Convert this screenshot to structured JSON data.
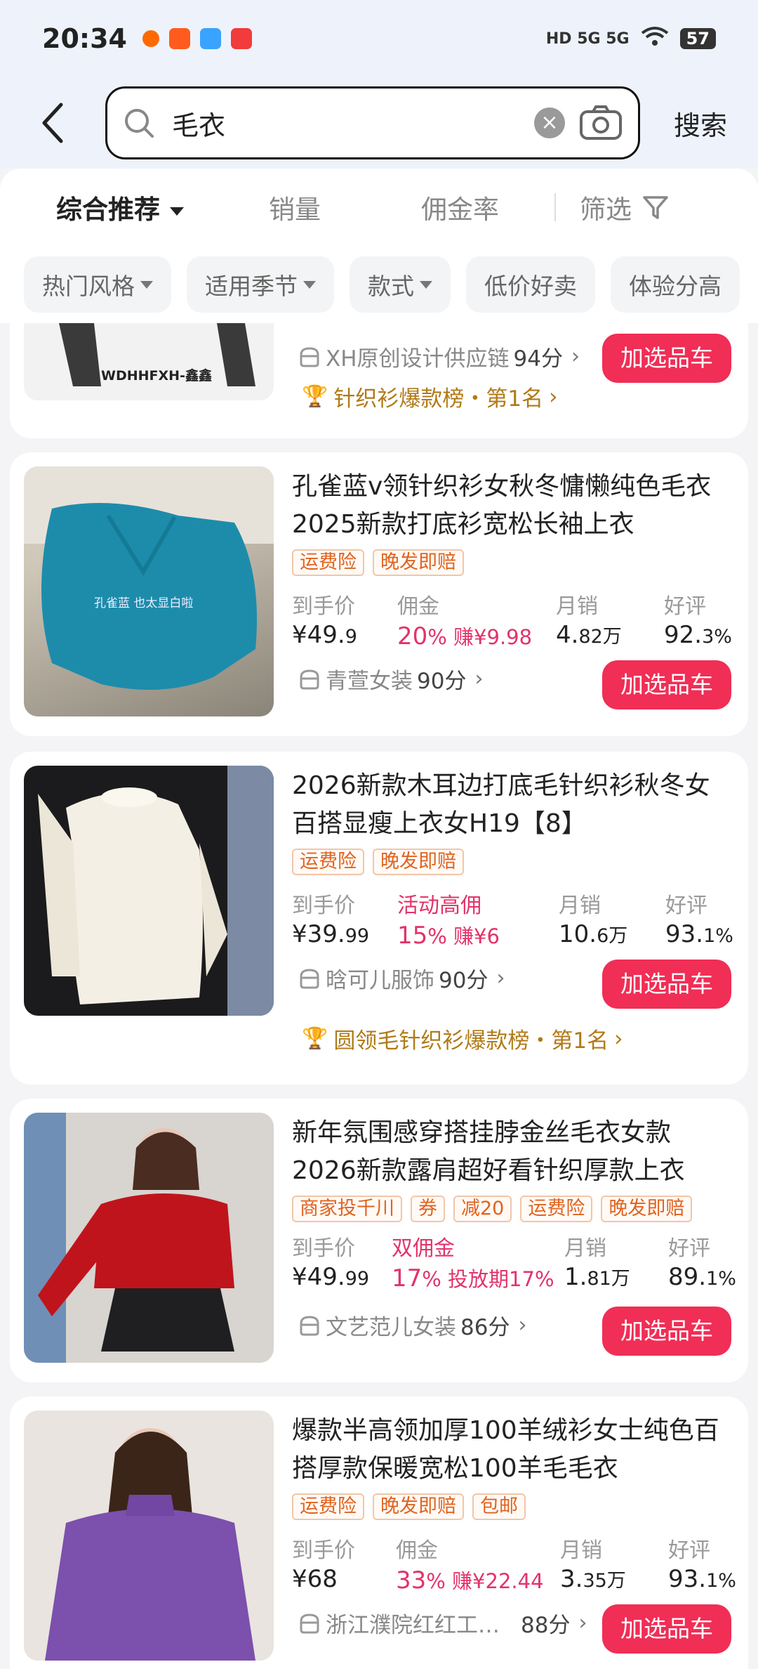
{
  "status": {
    "time": "20:34",
    "indicators": "HD 5G 5G",
    "battery": "57"
  },
  "search": {
    "query": "毛衣",
    "button": "搜索"
  },
  "sort": {
    "items": [
      "综合推荐",
      "销量",
      "佣金率",
      "筛选"
    ]
  },
  "chips": [
    "热门风格",
    "适用季节",
    "款式",
    "低价好卖",
    "体验分高"
  ],
  "products": [
    {
      "image_caption": "WDHHFXH-鑫鑫",
      "shop": "XH原创设计供应链",
      "shop_score": "94分",
      "add_label": "加选品车",
      "rank": "针织衫爆款榜・第1名"
    },
    {
      "title": "孔雀蓝v领针织衫女秋冬慵懒纯色毛衣2025新款打底衫宽松长袖上衣",
      "image_caption": "孔雀蓝 也太显白啦",
      "tags": [
        "运费险",
        "晚发即赔"
      ],
      "price_label": "到手价",
      "price": "¥49.",
      "price_small": "9",
      "commission_label": "佣金",
      "commission_pct": "20",
      "commission_pct_unit": "%",
      "commission_earn": " 赚¥9.98",
      "sales_label": "月销",
      "sales": "4.",
      "sales_small": "82万",
      "rating_label": "好评",
      "rating": "92.",
      "rating_small": "3%",
      "shop": "青萱女装",
      "shop_score": "90分",
      "add_label": "加选品车"
    },
    {
      "title": "2026新款木耳边打底毛针织衫秋冬女百搭显瘦上衣女H19【8】",
      "tags": [
        "运费险",
        "晚发即赔"
      ],
      "price_label": "到手价",
      "price": "¥39.",
      "price_small": "99",
      "commission_label": "活动高佣",
      "commission_pct": "15",
      "commission_pct_unit": "%",
      "commission_earn": " 赚¥6",
      "sales_label": "月销",
      "sales": "10.",
      "sales_small": "6万",
      "rating_label": "好评",
      "rating": "93.",
      "rating_small": "1%",
      "shop": "晗可儿服饰",
      "shop_score": "90分",
      "add_label": "加选品车",
      "rank": "圆领毛针织衫爆款榜・第1名"
    },
    {
      "title": "新年氛围感穿搭挂脖金丝毛衣女款2026新款露肩超好看针织厚款上衣",
      "tags": [
        "商家投千川",
        "券",
        "减20",
        "运费险",
        "晚发即赔"
      ],
      "price_label": "到手价",
      "price": "¥49.",
      "price_small": "99",
      "commission_label": "双佣金",
      "commission_pct": "17",
      "commission_pct_unit": "%",
      "commission_earn": " 投放期17%",
      "sales_label": "月销",
      "sales": "1.",
      "sales_small": "81万",
      "rating_label": "好评",
      "rating": "89.",
      "rating_small": "1%",
      "shop": "文艺范儿女装",
      "shop_score": "86分",
      "add_label": "加选品车"
    },
    {
      "title": "爆款半高领加厚100羊绒衫女士纯色百搭厚款保暖宽松100羊毛毛衣",
      "tags": [
        "运费险",
        "晚发即赔",
        "包邮"
      ],
      "price_label": "到手价",
      "price": "¥68",
      "price_small": "",
      "commission_label": "佣金",
      "commission_pct": "33",
      "commission_pct_unit": "%",
      "commission_earn": " 赚¥22.44",
      "sales_label": "月销",
      "sales": "3.",
      "sales_small": "35万",
      "rating_label": "好评",
      "rating": "93.",
      "rating_small": "1%",
      "shop": "浙江濮院红红工…",
      "shop_score": "88分",
      "add_label": "加选品车"
    }
  ],
  "colors": {
    "accent": "#f02e56",
    "commission": "#e2336a",
    "tag_text": "#e0631f",
    "rank_text": "#b07a17"
  }
}
